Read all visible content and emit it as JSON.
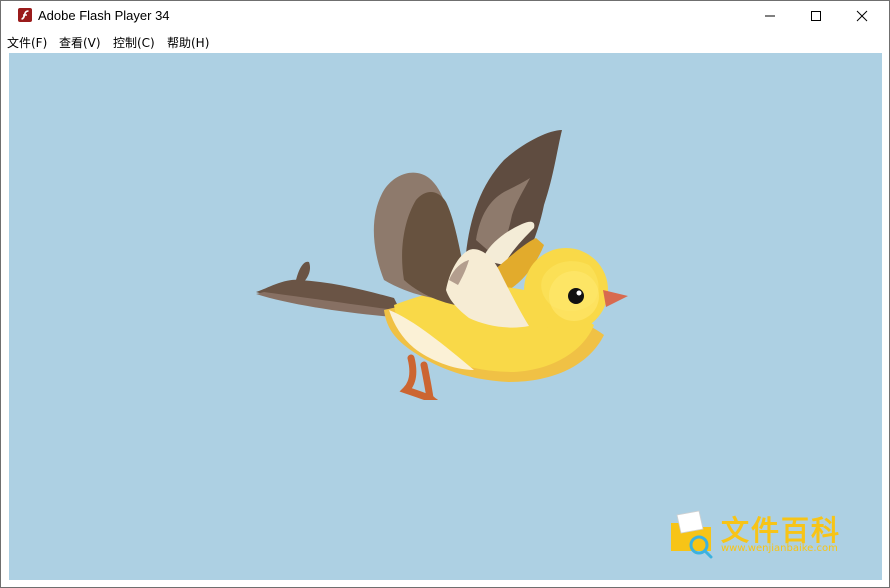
{
  "window": {
    "title": "Adobe Flash Player 34",
    "app_icon": "flash-player-icon",
    "controls": [
      "minimize-icon",
      "maximize-icon",
      "close-icon"
    ]
  },
  "menu": [
    {
      "label": "文件(F)"
    },
    {
      "label": "查看(V)"
    },
    {
      "label": "控制(C)"
    },
    {
      "label": "帮助(H)"
    }
  ],
  "stage": {
    "background": "#add0e3",
    "content": "bird-illustration"
  },
  "watermark": {
    "text": "文件百科",
    "url": "www.wenjianbaike.com",
    "color": "#f7c417"
  }
}
